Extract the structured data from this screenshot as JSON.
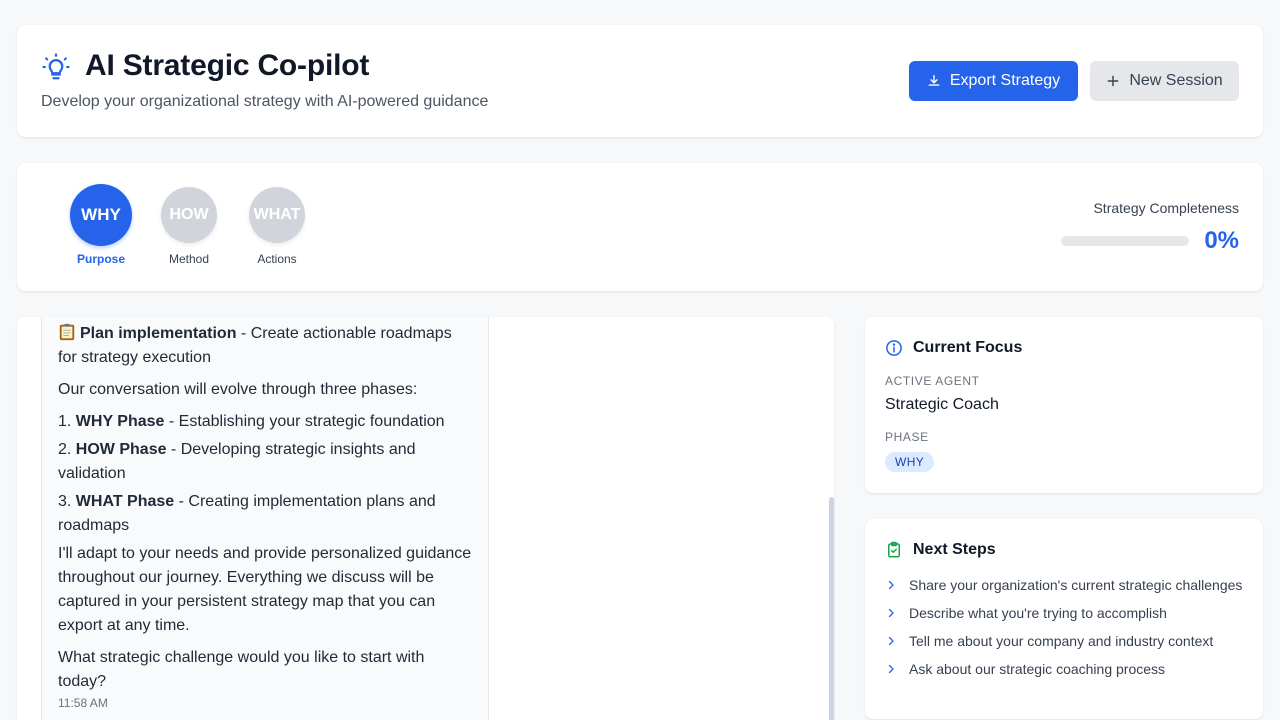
{
  "header": {
    "title": "AI Strategic Co-pilot",
    "subtitle": "Develop your organizational strategy with AI-powered guidance",
    "export_label": "Export Strategy",
    "new_session_label": "New Session"
  },
  "phases": [
    {
      "short": "WHY",
      "label": "Purpose",
      "active": true
    },
    {
      "short": "HOW",
      "label": "Method",
      "active": false
    },
    {
      "short": "WHAT",
      "label": "Actions",
      "active": false
    }
  ],
  "completeness": {
    "label": "Strategy Completeness",
    "value_text": "0%",
    "fraction": 0
  },
  "chat": {
    "message": {
      "item_bold": "Plan implementation",
      "item_rest": " - Create actionable roadmaps for strategy execution",
      "intro": "Our conversation will evolve through three phases:",
      "phases": [
        {
          "num": "1. ",
          "bold": "WHY Phase",
          "rest": " - Establishing your strategic foundation"
        },
        {
          "num": "2. ",
          "bold": "HOW Phase",
          "rest": " - Developing strategic insights and validation"
        },
        {
          "num": "3. ",
          "bold": "WHAT Phase",
          "rest": " - Creating implementation plans and roadmaps"
        }
      ],
      "adapt": "I'll adapt to your needs and provide personalized guidance throughout our journey. Everything we discuss will be captured in your persistent strategy map that you can export at any time.",
      "question": "What strategic challenge would you like to start with today?",
      "timestamp": "11:58 AM"
    }
  },
  "focus": {
    "title": "Current Focus",
    "agent_label": "ACTIVE AGENT",
    "agent_value": "Strategic Coach",
    "phase_label": "PHASE",
    "phase_value": "WHY"
  },
  "next_steps": {
    "title": "Next Steps",
    "items": [
      "Share your organization's current strategic challenges",
      "Describe what you're trying to accomplish",
      "Tell me about your company and industry context",
      "Ask about our strategic coaching process"
    ]
  },
  "colors": {
    "accent": "#2563eb",
    "inactive_phase": "#d1d5db",
    "success_icon": "#16a34a"
  },
  "icons": {
    "header": "lightbulb-icon",
    "export": "download-icon",
    "new_session": "plus-icon",
    "focus": "info-icon",
    "next_steps": "clipboard-check-icon",
    "step_bullet": "chevron-right-icon",
    "implementation": "clipboard-emoji-icon"
  }
}
